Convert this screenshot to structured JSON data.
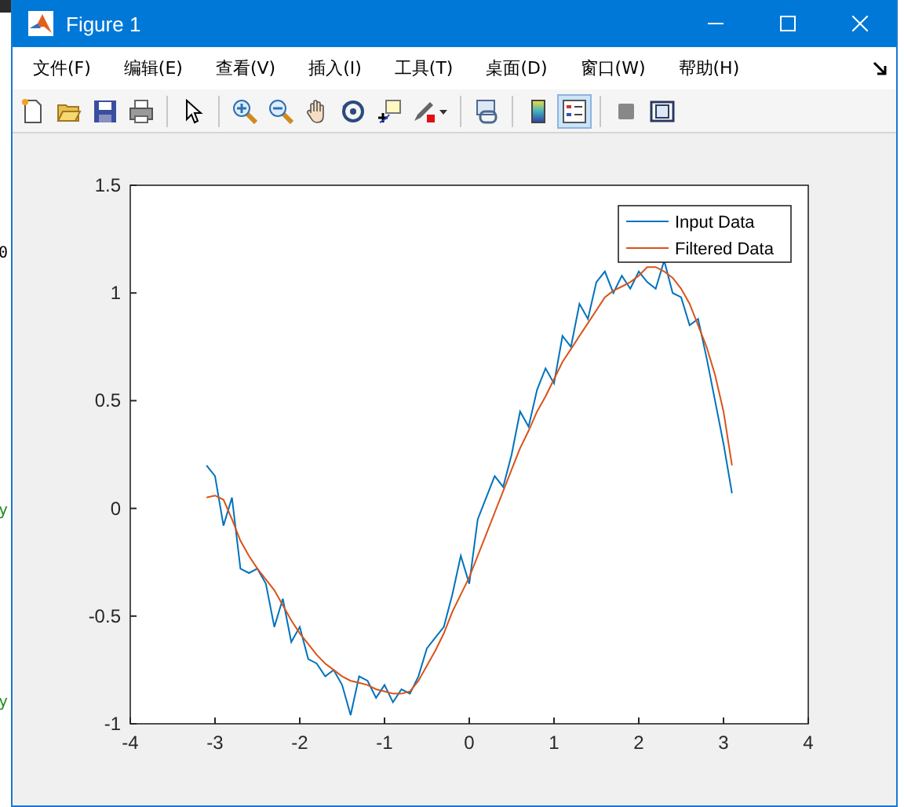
{
  "background": {
    "texts": [
      "0",
      "y",
      "y"
    ]
  },
  "window": {
    "title": "Figure 1"
  },
  "menu": [
    "文件(F)",
    "编辑(E)",
    "查看(V)",
    "插入(I)",
    "工具(T)",
    "桌面(D)",
    "窗口(W)",
    "帮助(H)"
  ],
  "toolbar": [
    {
      "kind": "new",
      "selected": false
    },
    {
      "kind": "open",
      "selected": false
    },
    {
      "kind": "save",
      "selected": false
    },
    {
      "kind": "print",
      "selected": false
    },
    {
      "kind": "sep"
    },
    {
      "kind": "pointer",
      "selected": false
    },
    {
      "kind": "sep"
    },
    {
      "kind": "zoomin",
      "selected": false
    },
    {
      "kind": "zoomout",
      "selected": false
    },
    {
      "kind": "pan",
      "selected": false
    },
    {
      "kind": "rotate",
      "selected": false
    },
    {
      "kind": "datatip",
      "selected": false
    },
    {
      "kind": "brush",
      "selected": false
    },
    {
      "kind": "sep"
    },
    {
      "kind": "link",
      "selected": false
    },
    {
      "kind": "sep"
    },
    {
      "kind": "colorbar",
      "selected": false
    },
    {
      "kind": "legend",
      "selected": true
    },
    {
      "kind": "sep"
    },
    {
      "kind": "hidetools",
      "selected": false
    },
    {
      "kind": "showtools",
      "selected": false
    }
  ],
  "chart_data": {
    "type": "line",
    "legend": "top right",
    "xlim": [
      -4,
      4
    ],
    "ylim": [
      -1,
      1.5
    ],
    "xticks": [
      -4,
      -3,
      -2,
      -1,
      0,
      1,
      2,
      3,
      4
    ],
    "yticks": [
      -1,
      -0.5,
      0,
      0.5,
      1,
      1.5
    ],
    "x": [
      -3.1,
      -3.0,
      -2.9,
      -2.8,
      -2.7,
      -2.6,
      -2.5,
      -2.4,
      -2.3,
      -2.2,
      -2.1,
      -2.0,
      -1.9,
      -1.8,
      -1.7,
      -1.6,
      -1.5,
      -1.4,
      -1.3,
      -1.2,
      -1.1,
      -1.0,
      -0.9,
      -0.8,
      -0.7,
      -0.6,
      -0.5,
      -0.4,
      -0.3,
      -0.2,
      -0.1,
      0.0,
      0.1,
      0.2,
      0.3,
      0.4,
      0.5,
      0.6,
      0.7,
      0.8,
      0.9,
      1.0,
      1.1,
      1.2,
      1.3,
      1.4,
      1.5,
      1.6,
      1.7,
      1.8,
      1.9,
      2.0,
      2.1,
      2.2,
      2.3,
      2.4,
      2.5,
      2.6,
      2.7,
      2.8,
      2.9,
      3.0,
      3.1
    ],
    "series": [
      {
        "name": "Input Data",
        "color": "#0072bd",
        "values": [
          0.2,
          0.15,
          -0.08,
          0.05,
          -0.28,
          -0.3,
          -0.28,
          -0.35,
          -0.55,
          -0.42,
          -0.62,
          -0.55,
          -0.7,
          -0.72,
          -0.78,
          -0.75,
          -0.82,
          -0.96,
          -0.78,
          -0.8,
          -0.88,
          -0.82,
          -0.9,
          -0.84,
          -0.86,
          -0.78,
          -0.65,
          -0.6,
          -0.55,
          -0.4,
          -0.22,
          -0.35,
          -0.05,
          0.05,
          0.15,
          0.1,
          0.25,
          0.45,
          0.38,
          0.55,
          0.65,
          0.58,
          0.8,
          0.75,
          0.95,
          0.88,
          1.05,
          1.1,
          1.0,
          1.08,
          1.02,
          1.1,
          1.05,
          1.02,
          1.15,
          1.0,
          0.98,
          0.85,
          0.88,
          0.7,
          0.5,
          0.3,
          0.07
        ]
      },
      {
        "name": "Filtered Data",
        "color": "#d95319",
        "values": [
          0.05,
          0.06,
          0.04,
          -0.05,
          -0.15,
          -0.22,
          -0.28,
          -0.33,
          -0.38,
          -0.45,
          -0.52,
          -0.58,
          -0.63,
          -0.68,
          -0.72,
          -0.75,
          -0.78,
          -0.8,
          -0.81,
          -0.82,
          -0.84,
          -0.85,
          -0.86,
          -0.86,
          -0.85,
          -0.8,
          -0.73,
          -0.66,
          -0.58,
          -0.48,
          -0.4,
          -0.32,
          -0.22,
          -0.12,
          -0.02,
          0.08,
          0.18,
          0.28,
          0.36,
          0.45,
          0.52,
          0.6,
          0.68,
          0.74,
          0.8,
          0.86,
          0.92,
          0.98,
          1.01,
          1.03,
          1.05,
          1.08,
          1.12,
          1.12,
          1.1,
          1.07,
          1.02,
          0.95,
          0.85,
          0.75,
          0.62,
          0.45,
          0.2
        ]
      }
    ]
  }
}
